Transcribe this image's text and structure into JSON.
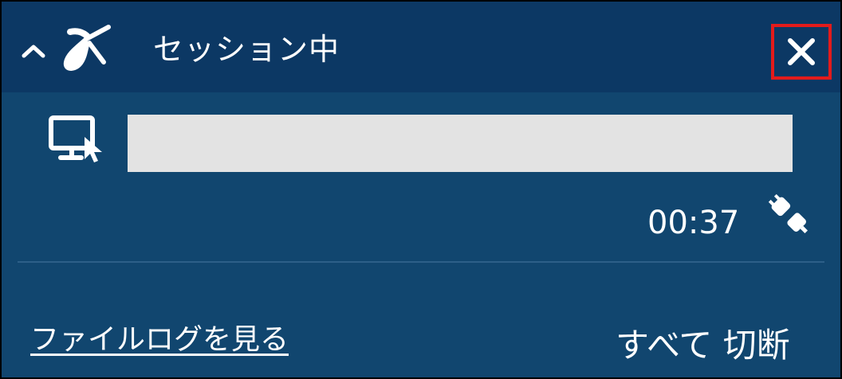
{
  "window": {
    "title": "セッション中"
  },
  "session": {
    "elapsed_time": "00:37"
  },
  "footer": {
    "file_log_link": "ファイルログを見る",
    "disconnect_all_label": "すべて 切断"
  },
  "icons": {
    "collapse": "chevron-up-icon",
    "logo": "splashtop-logo-icon",
    "close": "close-icon",
    "remote_screen": "remote-screen-icon",
    "connection": "plug-connection-icon"
  },
  "colors": {
    "titlebar": "#0c3864",
    "body": "#11466f",
    "session_bar": "#e3e3e3",
    "close_highlight": "#e31b1b"
  }
}
